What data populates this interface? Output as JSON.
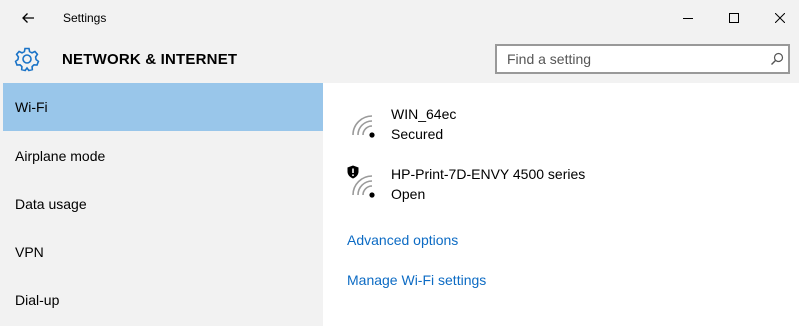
{
  "window": {
    "title": "Settings",
    "back_icon": "back-arrow-icon",
    "controls": [
      "minimize-icon",
      "maximize-icon",
      "close-icon"
    ]
  },
  "header": {
    "icon": "gear-icon",
    "title": "NETWORK & INTERNET",
    "search_placeholder": "Find a setting",
    "search_icon": "search-icon",
    "accent_color": "#1a73c7"
  },
  "sidebar": {
    "selected_color": "#99c6ea",
    "items": [
      {
        "label": "Wi-Fi",
        "selected": true
      },
      {
        "label": "Airplane mode",
        "selected": false
      },
      {
        "label": "Data usage",
        "selected": false
      },
      {
        "label": "VPN",
        "selected": false
      },
      {
        "label": "Dial-up",
        "selected": false
      }
    ]
  },
  "main": {
    "networks": [
      {
        "name": "WIN_64ec",
        "status": "Secured",
        "icon": "wifi-signal-icon"
      },
      {
        "name": "HP-Print-7D-ENVY 4500 series",
        "status": "Open",
        "icon": "wifi-signal-icon",
        "badge_icon": "shield-warning-icon"
      }
    ],
    "links": [
      {
        "label": "Advanced options"
      },
      {
        "label": "Manage Wi-Fi settings"
      }
    ],
    "link_color": "#0c6bc4"
  }
}
